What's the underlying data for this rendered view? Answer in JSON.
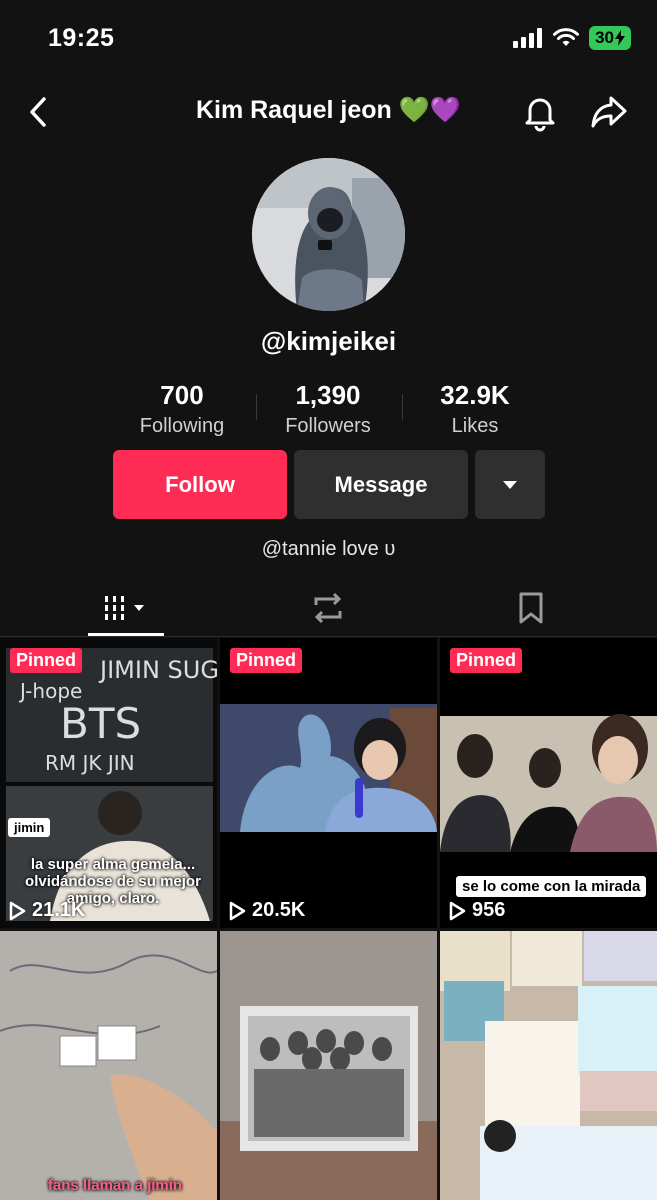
{
  "status_bar": {
    "time": "19:25",
    "battery": "30"
  },
  "header": {
    "title": "Kim Raquel jeon 💚💜"
  },
  "profile": {
    "username": "@kimjeikei",
    "stats": [
      {
        "value": "700",
        "label": "Following"
      },
      {
        "value": "1,390",
        "label": "Followers"
      },
      {
        "value": "32.9K",
        "label": "Likes"
      }
    ],
    "follow_label": "Follow",
    "message_label": "Message",
    "bio": "@tannie love ᴜ"
  },
  "videos": [
    {
      "pinned": "Pinned",
      "views": "21.1K",
      "label": "jimin",
      "subtitle": "la super alma gemela... olvidándose de su mejor amigo, claro."
    },
    {
      "pinned": "Pinned",
      "views": "20.5K"
    },
    {
      "pinned": "Pinned",
      "views": "956",
      "caption": "se lo come con la mirada"
    },
    {
      "subtitle": "fans llaman a jimin"
    },
    {},
    {}
  ],
  "colors": {
    "accent": "#fe2c55",
    "background": "#121212",
    "button_dark": "#2f2f2f"
  }
}
